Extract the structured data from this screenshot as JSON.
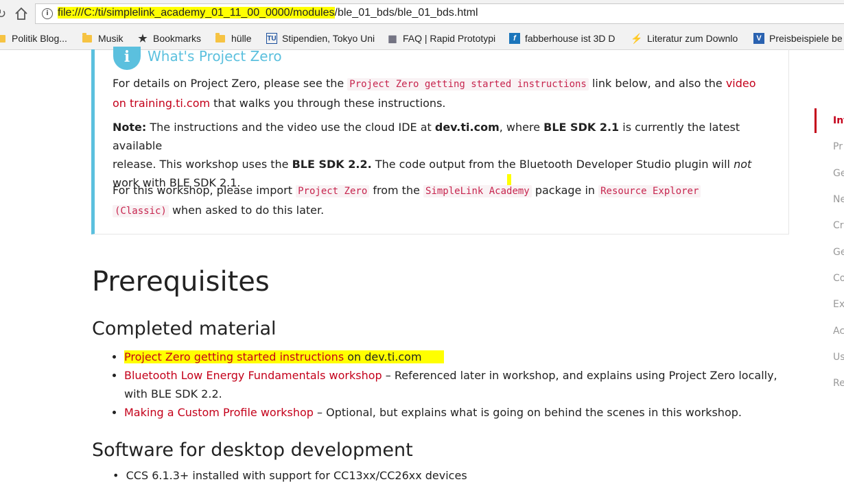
{
  "browser": {
    "url_highlighted": "file:///C:/ti/simplelink_academy_01_11_00_0000/modules",
    "url_rest": "/ble_01_bds/ble_01_bds.html",
    "bookmarks": [
      {
        "label": "Politik Blog...",
        "icon": "folder-icon"
      },
      {
        "label": "Musik",
        "icon": "folder-icon"
      },
      {
        "label": "Bookmarks",
        "icon": "star-icon"
      },
      {
        "label": "hülle",
        "icon": "folder-icon"
      },
      {
        "label": "Stipendien, Tokyo Uni",
        "icon": "tu-icon"
      },
      {
        "label": "FAQ | Rapid Prototypi",
        "icon": "cube-icon"
      },
      {
        "label": "fabberhouse ist 3D D",
        "icon": "f-icon"
      },
      {
        "label": "Literatur zum Downlo",
        "icon": "runner-icon"
      },
      {
        "label": "Preisbeispiele be",
        "icon": "v-icon"
      }
    ]
  },
  "note": {
    "title": "What's Project Zero",
    "p1": {
      "a": "For details on Project Zero, please see the ",
      "code": "Project Zero getting started instructions",
      "b": " link below, and also the ",
      "link1": "video",
      "link2": "on training.ti.com",
      "c": " that walks you through these instructions."
    },
    "p2": {
      "label": "Note:",
      "a": " The instructions and the video use the cloud IDE at ",
      "b1": "dev.ti.com",
      "b": ", where ",
      "b2": "BLE SDK 2.1",
      "c": " is currently the latest available",
      "d": "release. This workshop uses the ",
      "b3": "BLE SDK 2.2.",
      "e": " The code output from the Bluetooth Developer Studio plugin will ",
      "em": "not",
      "f": "work with BLE SDK 2.1."
    },
    "p3": {
      "a": "For this workshop, please import ",
      "code1": "Project Zero",
      "b": " from the ",
      "code2": "SimpleLink Academy",
      "c": " package in ",
      "code3a": "Resource Explorer",
      "code3b": "(Classic)",
      "d": " when asked to do this later."
    }
  },
  "prereq": {
    "title": "Prerequisites",
    "completed_title": "Completed material",
    "items": [
      {
        "link": "Project Zero getting started instructions",
        "text": " on dev.ti.com"
      },
      {
        "link": "Bluetooth Low Energy Fundamentals workshop",
        "text": " – Referenced later in workshop, and explains using Project Zero locally,",
        "text2": "with BLE SDK 2.2."
      },
      {
        "link": "Making a Custom Profile workshop",
        "text": " – Optional, but explains what is going on behind the scenes in this workshop."
      }
    ],
    "software_title": "Software for desktop development",
    "cut_line": "CCS 6.1.3+ installed with support for CC13xx/CC26xx devices"
  },
  "toc": [
    "Int",
    "Pr",
    "Ge",
    "Ne",
    "Cr",
    "Ge",
    "Co",
    "Ex",
    "Ac",
    "Us",
    "Re"
  ]
}
